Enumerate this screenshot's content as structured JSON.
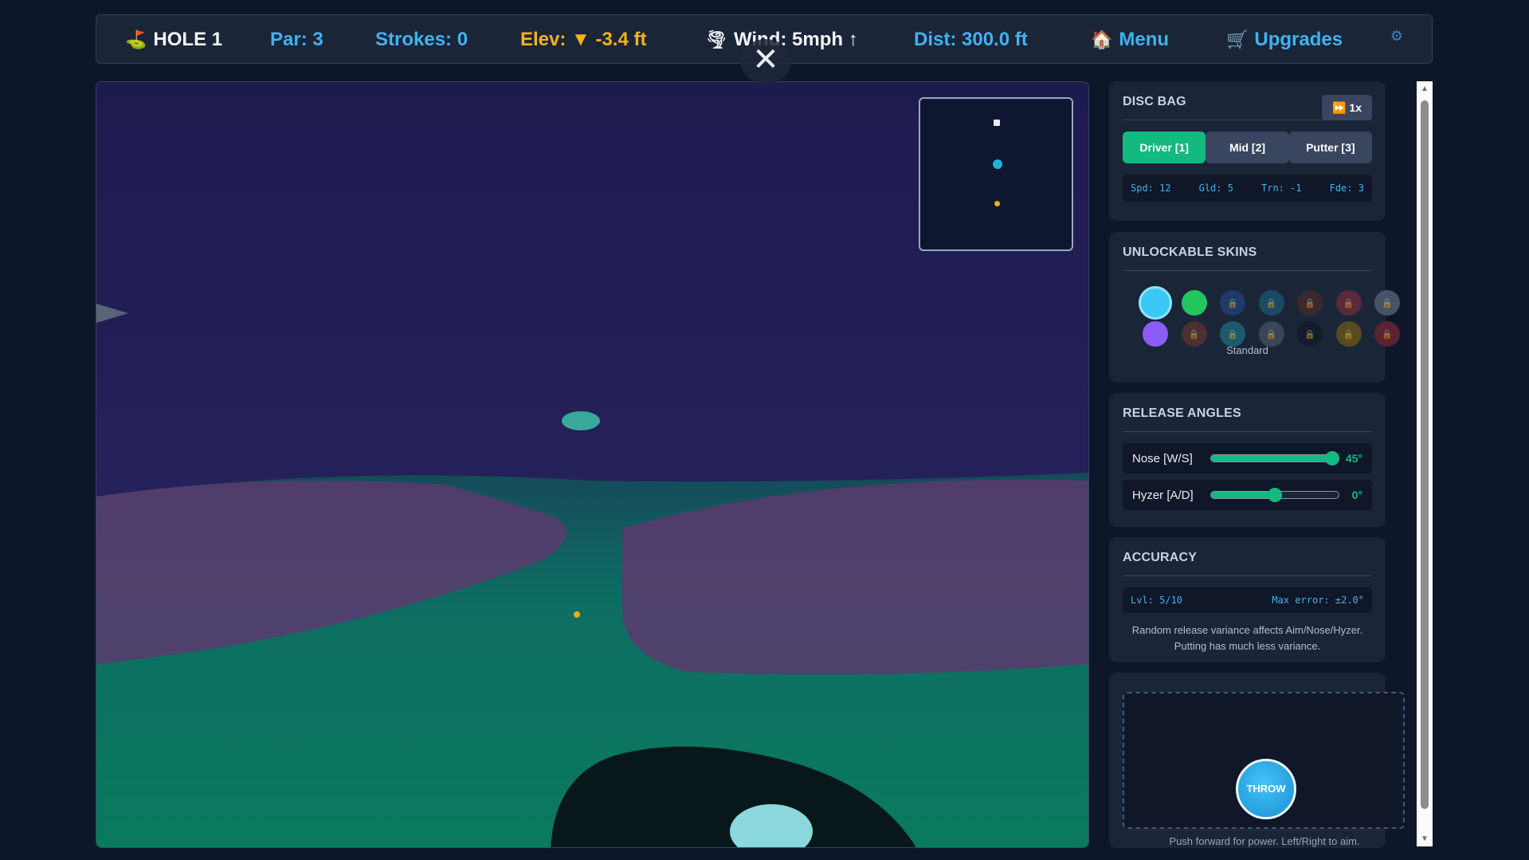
{
  "hud": {
    "hole": "HOLE 1",
    "par": "Par: 3",
    "strokes": "Strokes: 0",
    "elev": "Elev: ▼ -3.4 ft",
    "wind": "Wind: 5mph ↑",
    "dist": "Dist: 300.0 ft",
    "menu": "Menu",
    "upgrades": "Upgrades",
    "close_symbol": "✕"
  },
  "icons": {
    "hole": "flag-icon",
    "wind": "wind-icon",
    "menu": "house-icon",
    "upgrades": "cart-icon",
    "settings": "gear-icon",
    "speed": "fast-forward-icon",
    "lock": "lock-icon"
  },
  "disc_bag": {
    "title": "DISC BAG",
    "speed": "1x",
    "discs": [
      {
        "label": "Driver [1]",
        "active": true
      },
      {
        "label": "Mid [2]",
        "active": false
      },
      {
        "label": "Putter [3]",
        "active": false
      }
    ],
    "stats": {
      "spd": "Spd: 12",
      "gld": "Gld: 5",
      "trn": "Trn: -1",
      "fde": "Fde: 3"
    }
  },
  "skins": {
    "title": "UNLOCKABLE SKINS",
    "selected_name": "Standard",
    "items": [
      {
        "color": "#3cc8f5",
        "locked": false,
        "selected": true
      },
      {
        "color": "#22c55e",
        "locked": false
      },
      {
        "color": "#1f3a6b",
        "locked": true
      },
      {
        "color": "#1b4a63",
        "locked": true
      },
      {
        "color": "#3a2a30",
        "locked": true
      },
      {
        "color": "#5a2a3a",
        "locked": true
      },
      {
        "color": "#4a5266",
        "locked": true
      },
      {
        "color": "#8b5cf6",
        "locked": false
      },
      {
        "color": "#4a3030",
        "locked": true
      },
      {
        "color": "#1d5a6e",
        "locked": true
      },
      {
        "color": "#3a4558",
        "locked": true
      },
      {
        "color": "#141b2c",
        "locked": true
      },
      {
        "color": "#5a4a22",
        "locked": true
      },
      {
        "color": "#5a2232",
        "locked": true
      }
    ]
  },
  "release": {
    "title": "RELEASE ANGLES",
    "nose": {
      "label": "Nose [W/S]",
      "value": "45°",
      "fraction": 0.95
    },
    "hyzer": {
      "label": "Hyzer [A/D]",
      "value": "0°",
      "fraction": 0.5
    }
  },
  "accuracy": {
    "title": "ACCURACY",
    "level": "Lvl: 5/10",
    "max_error": "Max error: ±2.0°",
    "note1": "Random release variance affects Aim/Nose/Hyzer.",
    "note2": "Putting has much less variance."
  },
  "throw": {
    "label": "THROW",
    "hint": "Push forward for power. Left/Right to aim."
  }
}
